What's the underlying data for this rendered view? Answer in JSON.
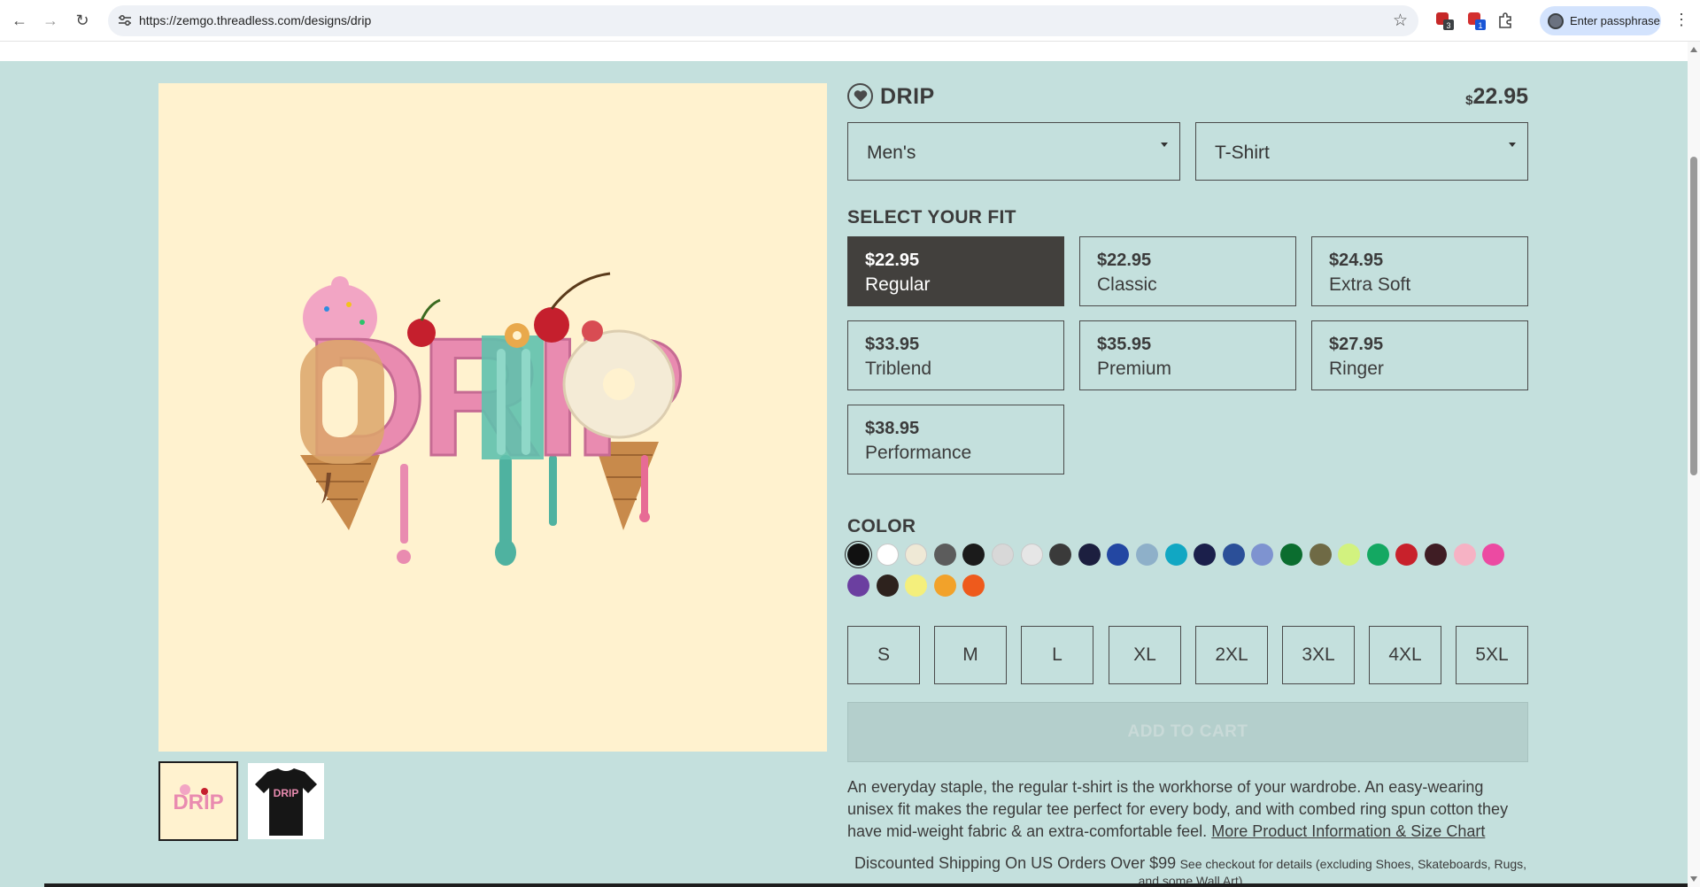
{
  "browser": {
    "url": "https://zemgo.threadless.com/designs/drip",
    "extension_badges": [
      "3",
      "1"
    ],
    "profile_button_label": "Enter passphrase"
  },
  "product": {
    "title": "DRIP",
    "price_currency": "$",
    "price_amount": "22.95",
    "gender_select": "Men's",
    "style_select": "T-Shirt"
  },
  "fit": {
    "heading": "SELECT YOUR FIT",
    "options": [
      {
        "price": "$22.95",
        "name": "Regular",
        "selected": true
      },
      {
        "price": "$22.95",
        "name": "Classic",
        "selected": false
      },
      {
        "price": "$24.95",
        "name": "Extra Soft",
        "selected": false
      },
      {
        "price": "$33.95",
        "name": "Triblend",
        "selected": false
      },
      {
        "price": "$35.95",
        "name": "Premium",
        "selected": false
      },
      {
        "price": "$27.95",
        "name": "Ringer",
        "selected": false
      },
      {
        "price": "$38.95",
        "name": "Performance",
        "selected": false
      }
    ]
  },
  "color": {
    "heading": "COLOR",
    "swatches": [
      "#111111",
      "#ffffff",
      "#efe9d6",
      "#5c5c5c",
      "#1b1b1b",
      "#d8d8d8",
      "#e6e6e6",
      "#3a3a3a",
      "#1c1f3f",
      "#2347a2",
      "#8eb0c9",
      "#11a7c3",
      "#1b1f4b",
      "#2b4f98",
      "#7e93d0",
      "#0b6d2f",
      "#6f6a45",
      "#d2f27f",
      "#14a862",
      "#c8212b",
      "#3f1d24",
      "#f6b2c4",
      "#ec4aa2",
      "#6b3fa0",
      "#2d221d",
      "#f4ef7c",
      "#f2a22a",
      "#ee5a1c"
    ],
    "selected_index": 0
  },
  "sizes": [
    "S",
    "M",
    "L",
    "XL",
    "2XL",
    "3XL",
    "4XL",
    "5XL"
  ],
  "cart": {
    "label": "ADD TO CART"
  },
  "description": {
    "text": "An everyday staple, the regular t-shirt is the workhorse of your wardrobe. An easy-wearing unisex fit makes the regular tee perfect for every body, and with combed ring spun cotton they have mid-weight fabric & an extra-comfortable feel.",
    "link": "More Product Information & Size Chart"
  },
  "shipping": {
    "headline": "Discounted Shipping On US Orders Over $99",
    "note": "See checkout for details (excluding Shoes, Skateboards, Rugs, and some Wall Art)"
  },
  "artwork": {
    "word": "DRIP"
  }
}
